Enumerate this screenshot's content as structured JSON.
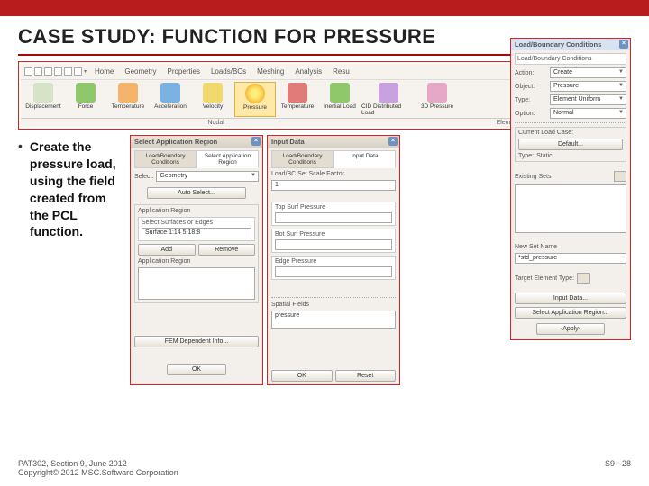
{
  "title": "CASE STUDY: FUNCTION FOR PRESSURE",
  "bullet": "Create the pressure load, using the field created from the PCL function.",
  "ribbon": {
    "tabs": [
      "Home",
      "Geometry",
      "Properties",
      "Loads/BCs",
      "Meshing",
      "Analysis",
      "Resu"
    ],
    "items": [
      "Displacement",
      "Force",
      "Temperature",
      "Acceleration",
      "Velocity",
      "Pressure",
      "Temperature",
      "Inertial Load",
      "CID Distributed Load",
      "3D Pressure"
    ],
    "sections": [
      "Nodal",
      "Element Uniform"
    ]
  },
  "panel1": {
    "title": "Select Application Region",
    "tabs": [
      "Load/Boundary Conditions",
      "Select Application Region"
    ],
    "select_label": "Select:",
    "select_value": "Geometry",
    "auto_btn": "Auto Select...",
    "group_label": "Application Region",
    "subgroup_label": "Select Surfaces or Edges",
    "surf_value": "Surface 1:14 5 18:8",
    "add_btn": "Add",
    "remove_btn": "Remove",
    "appreg_label": "Application Region",
    "fem_btn": "FEM Dependent Info...",
    "ok_btn": "OK"
  },
  "panel2": {
    "title": "Input Data",
    "tabs": [
      "Load/Boundary Conditions",
      "Input Data"
    ],
    "setname": "Load/BC Set Scale Factor",
    "setval": "1",
    "top_label": "Top Surf Pressure",
    "bot_label": "Bot Surf Pressure",
    "edge_label": "Edge Pressure",
    "spatial_label": "Spatial Fields",
    "spatial_val": "pressure",
    "ok_btn": "OK",
    "reset_btn": "Reset"
  },
  "panel3": {
    "title": "Load/Boundary Conditions",
    "subtitle": "Load/Boundary Conditions",
    "action_lbl": "Action:",
    "action": "Create",
    "object_lbl": "Object:",
    "object": "Pressure",
    "type_lbl": "Type:",
    "type": "Element Uniform",
    "option_lbl": "Option:",
    "option": "Normal",
    "loadcase_lbl": "Current Load Case:",
    "loadcase_val": "Default...",
    "lc_type_lbl": "Type:",
    "lc_type": "Static",
    "ex_label": "Existing Sets",
    "setname_lbl": "New Set Name",
    "setname_val": "*std_pressure",
    "target_lbl": "Target Element Type:",
    "btn_input": "Input Data...",
    "btn_sel": "Select Application Region...",
    "btn_apply": "-Apply-"
  },
  "footer": {
    "left1": "PAT302, Section 9, June 2012",
    "left2": "Copyright© 2012 MSC.Software Corporation",
    "right": "S9 - 28"
  }
}
